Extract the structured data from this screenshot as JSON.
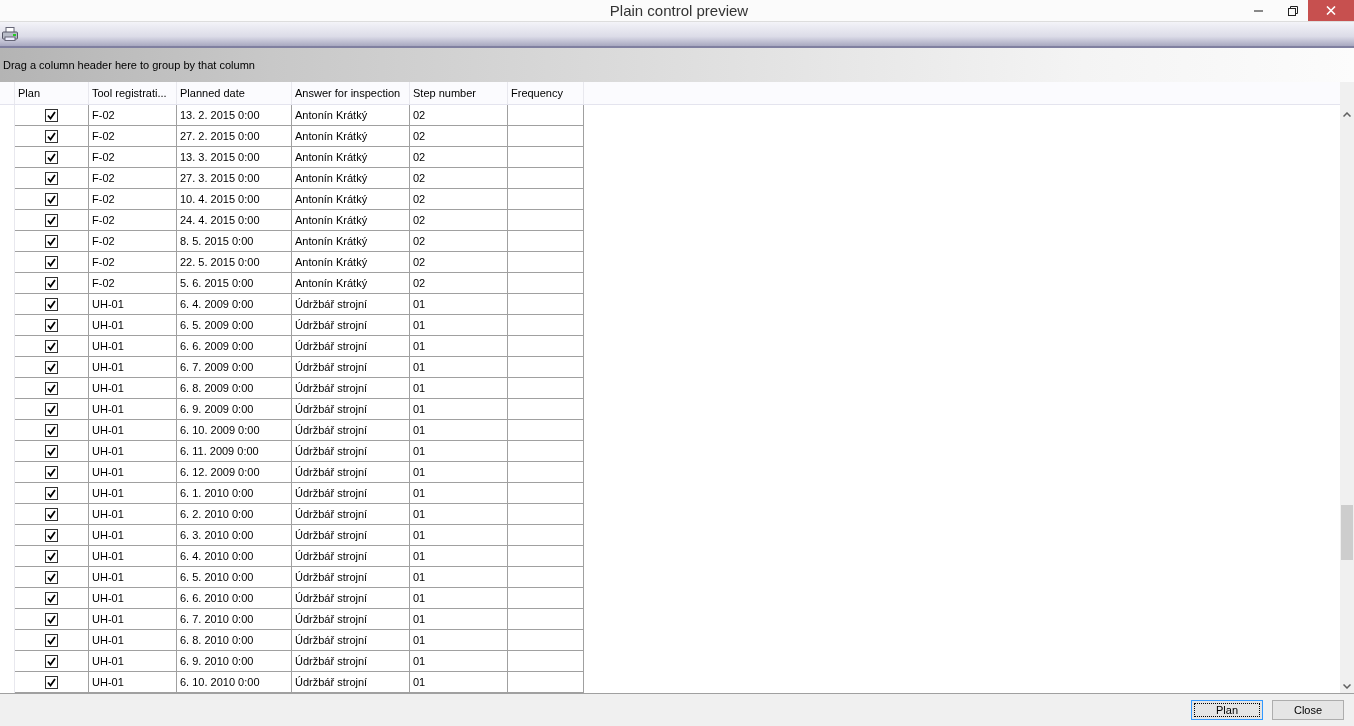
{
  "window": {
    "title": "Plain control preview"
  },
  "group_panel": {
    "hint": "Drag a column header here to group by that column"
  },
  "table": {
    "columns": [
      "Plan",
      "Tool registrati...",
      "Planned date",
      "Answer for inspection",
      "Step number",
      "Frequency"
    ],
    "rows": [
      {
        "plan": true,
        "tool": "F-02",
        "date": "13. 2. 2015 0:00",
        "answer": "Antonín Krátký",
        "step": "02"
      },
      {
        "plan": true,
        "tool": "F-02",
        "date": "27. 2. 2015 0:00",
        "answer": "Antonín Krátký",
        "step": "02"
      },
      {
        "plan": true,
        "tool": "F-02",
        "date": "13. 3. 2015 0:00",
        "answer": "Antonín Krátký",
        "step": "02"
      },
      {
        "plan": true,
        "tool": "F-02",
        "date": "27. 3. 2015 0:00",
        "answer": "Antonín Krátký",
        "step": "02"
      },
      {
        "plan": true,
        "tool": "F-02",
        "date": "10. 4. 2015 0:00",
        "answer": "Antonín Krátký",
        "step": "02"
      },
      {
        "plan": true,
        "tool": "F-02",
        "date": "24. 4. 2015 0:00",
        "answer": "Antonín Krátký",
        "step": "02"
      },
      {
        "plan": true,
        "tool": "F-02",
        "date": "8. 5. 2015 0:00",
        "answer": "Antonín Krátký",
        "step": "02"
      },
      {
        "plan": true,
        "tool": "F-02",
        "date": "22. 5. 2015 0:00",
        "answer": "Antonín Krátký",
        "step": "02"
      },
      {
        "plan": true,
        "tool": "F-02",
        "date": "5. 6. 2015 0:00",
        "answer": "Antonín Krátký",
        "step": "02"
      },
      {
        "plan": true,
        "tool": "UH-01",
        "date": "6. 4. 2009 0:00",
        "answer": "Údržbář strojní",
        "step": "01"
      },
      {
        "plan": true,
        "tool": "UH-01",
        "date": "6. 5. 2009 0:00",
        "answer": "Údržbář strojní",
        "step": "01"
      },
      {
        "plan": true,
        "tool": "UH-01",
        "date": "6. 6. 2009 0:00",
        "answer": "Údržbář strojní",
        "step": "01"
      },
      {
        "plan": true,
        "tool": "UH-01",
        "date": "6. 7. 2009 0:00",
        "answer": "Údržbář strojní",
        "step": "01"
      },
      {
        "plan": true,
        "tool": "UH-01",
        "date": "6. 8. 2009 0:00",
        "answer": "Údržbář strojní",
        "step": "01"
      },
      {
        "plan": true,
        "tool": "UH-01",
        "date": "6. 9. 2009 0:00",
        "answer": "Údržbář strojní",
        "step": "01"
      },
      {
        "plan": true,
        "tool": "UH-01",
        "date": "6. 10. 2009 0:00",
        "answer": "Údržbář strojní",
        "step": "01"
      },
      {
        "plan": true,
        "tool": "UH-01",
        "date": "6. 11. 2009 0:00",
        "answer": "Údržbář strojní",
        "step": "01"
      },
      {
        "plan": true,
        "tool": "UH-01",
        "date": "6. 12. 2009 0:00",
        "answer": "Údržbář strojní",
        "step": "01"
      },
      {
        "plan": true,
        "tool": "UH-01",
        "date": "6. 1. 2010 0:00",
        "answer": "Údržbář strojní",
        "step": "01"
      },
      {
        "plan": true,
        "tool": "UH-01",
        "date": "6. 2. 2010 0:00",
        "answer": "Údržbář strojní",
        "step": "01"
      },
      {
        "plan": true,
        "tool": "UH-01",
        "date": "6. 3. 2010 0:00",
        "answer": "Údržbář strojní",
        "step": "01"
      },
      {
        "plan": true,
        "tool": "UH-01",
        "date": "6. 4. 2010 0:00",
        "answer": "Údržbář strojní",
        "step": "01"
      },
      {
        "plan": true,
        "tool": "UH-01",
        "date": "6. 5. 2010 0:00",
        "answer": "Údržbář strojní",
        "step": "01"
      },
      {
        "plan": true,
        "tool": "UH-01",
        "date": "6. 6. 2010 0:00",
        "answer": "Údržbář strojní",
        "step": "01"
      },
      {
        "plan": true,
        "tool": "UH-01",
        "date": "6. 7. 2010 0:00",
        "answer": "Údržbář strojní",
        "step": "01"
      },
      {
        "plan": true,
        "tool": "UH-01",
        "date": "6. 8. 2010 0:00",
        "answer": "Údržbář strojní",
        "step": "01"
      },
      {
        "plan": true,
        "tool": "UH-01",
        "date": "6. 9. 2010 0:00",
        "answer": "Údržbář strojní",
        "step": "01"
      },
      {
        "plan": true,
        "tool": "UH-01",
        "date": "6. 10. 2010 0:00",
        "answer": "Údržbář strojní",
        "step": "01"
      }
    ]
  },
  "buttons": [
    {
      "label": "Plan",
      "focused": true
    },
    {
      "label": "Close",
      "focused": false
    }
  ]
}
